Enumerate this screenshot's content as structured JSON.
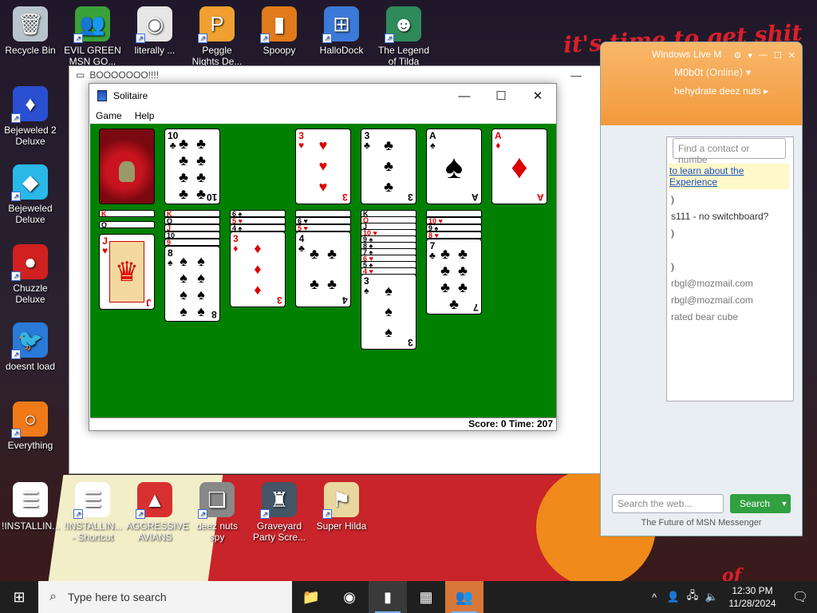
{
  "wallpaper": {
    "banner_text": "it's time to get shit",
    "bottom_text": "of"
  },
  "desktop_icons": [
    {
      "label": "Recycle Bin",
      "glyph": "🗑",
      "bg": "#b8c4cc",
      "shortcut": false
    },
    {
      "label": "EVIL GREEN MSN GO...",
      "glyph": "👥",
      "bg": "#3aa23a",
      "shortcut": true
    },
    {
      "label": "literally ...",
      "glyph": "◉",
      "bg": "#e6e6e6",
      "shortcut": true
    },
    {
      "label": "Peggle Nights De...",
      "glyph": "P",
      "bg": "#f0a030",
      "shortcut": true
    },
    {
      "label": "Spoopy",
      "glyph": "▮",
      "bg": "#e07a1a",
      "shortcut": true
    },
    {
      "label": "HalloDock",
      "glyph": "⊞",
      "bg": "#3b7ad8",
      "shortcut": true
    },
    {
      "label": "The Legend of Tilda",
      "glyph": "☻",
      "bg": "#2f8a5a",
      "shortcut": true
    },
    {
      "label": "Bejeweled 2 Deluxe",
      "glyph": "♦",
      "bg": "#2a4fd0",
      "shortcut": true
    },
    {
      "label": "Bejeweled Deluxe",
      "glyph": "◆",
      "bg": "#2ab8e8",
      "shortcut": true
    },
    {
      "label": "Chuzzle Deluxe",
      "glyph": "●",
      "bg": "#d02020",
      "shortcut": true
    },
    {
      "label": "doesnt load",
      "glyph": "🐦",
      "bg": "#2a7ad8",
      "shortcut": true
    },
    {
      "label": "Everything",
      "glyph": "○",
      "bg": "#f07a1a",
      "shortcut": true
    },
    {
      "label": "!INSTALLIN...",
      "glyph": "☰",
      "bg": "#ffffff",
      "shortcut": false
    },
    {
      "label": "!INSTALLIN... - Shortcut",
      "glyph": "☰",
      "bg": "#ffffff",
      "shortcut": true
    },
    {
      "label": "AGGRESSIVE AVIANS",
      "glyph": "▲",
      "bg": "#d83030",
      "shortcut": true
    },
    {
      "label": "deez nuts spy",
      "glyph": "❏",
      "bg": "#888888",
      "shortcut": true
    },
    {
      "label": "Graveyard Party Scre...",
      "glyph": "♜",
      "bg": "#445566",
      "shortcut": true
    },
    {
      "label": "Super Hilda",
      "glyph": "⚑",
      "bg": "#e8d8a0",
      "shortcut": true
    }
  ],
  "ghost_window": {
    "title": "BOOOOOOO!!!!"
  },
  "solitaire": {
    "title": "Solitaire",
    "menu": [
      "Game",
      "Help"
    ],
    "minimize": "—",
    "maximize": "☐",
    "close": "✕",
    "score_label": "Score: 0 Time: 207",
    "stock": {
      "back": true
    },
    "waste": {
      "rank": "10",
      "suit": "♣",
      "color": "b"
    },
    "foundations": [
      {
        "rank": "3",
        "suit": "♥",
        "color": "r"
      },
      {
        "rank": "3",
        "suit": "♣",
        "color": "b"
      },
      {
        "rank": "A",
        "suit": "♠",
        "color": "b"
      },
      {
        "rank": "A",
        "suit": "♦",
        "color": "r"
      }
    ],
    "tableau": [
      {
        "strips": [
          {
            "t": "K",
            "c": "r"
          },
          {
            "t": "Q",
            "c": "b"
          }
        ],
        "top": {
          "rank": "J",
          "suit": "♥",
          "color": "r"
        }
      },
      {
        "strips": [
          {
            "t": "K",
            "c": "r"
          },
          {
            "t": "Q",
            "c": "b"
          },
          {
            "t": "J",
            "c": "r"
          },
          {
            "t": "10",
            "c": "b"
          },
          {
            "t": "9",
            "c": "r"
          }
        ],
        "top": {
          "rank": "8",
          "suit": "♠",
          "color": "b"
        }
      },
      {
        "strips": [
          {
            "t": "6 ♠",
            "c": "b"
          },
          {
            "t": "5 ♥",
            "c": "r"
          },
          {
            "t": "4 ♠",
            "c": "b"
          }
        ],
        "top": {
          "rank": "3",
          "suit": "♦",
          "color": "r"
        }
      },
      {
        "strips": [
          {
            "t": "",
            "c": "b"
          },
          {
            "t": "6 ♥",
            "c": "b"
          },
          {
            "t": "5 ♥",
            "c": "r"
          }
        ],
        "top": {
          "rank": "4",
          "suit": "♣",
          "color": "b"
        }
      },
      {
        "strips": [
          {
            "t": "K",
            "c": "b"
          },
          {
            "t": "Q",
            "c": "r"
          },
          {
            "t": "J",
            "c": "b"
          },
          {
            "t": "10 ♥",
            "c": "r"
          },
          {
            "t": "9 ♠",
            "c": "b"
          },
          {
            "t": "8 ♠",
            "c": "b"
          },
          {
            "t": "7 ♠",
            "c": "b"
          },
          {
            "t": "6 ♥",
            "c": "r"
          },
          {
            "t": "5 ♠",
            "c": "b"
          },
          {
            "t": "4 ♥",
            "c": "r"
          }
        ],
        "top": {
          "rank": "3",
          "suit": "♠",
          "color": "b"
        }
      },
      {
        "strips": [
          {
            "t": "",
            "c": "b"
          },
          {
            "t": "10 ♥",
            "c": "r"
          },
          {
            "t": "9 ♠",
            "c": "b"
          },
          {
            "t": "8 ♥",
            "c": "r"
          }
        ],
        "top": {
          "rank": "7",
          "suit": "♣",
          "color": "b"
        }
      }
    ]
  },
  "msn": {
    "title": "Windows Live M",
    "username": "M0b0t",
    "status": "(Online) ▾",
    "personal_message": "hehydrate deez nuts ▸",
    "find_placeholder": "Find a contact or numbe",
    "tip_text": "to learn about the Experience",
    "contacts": [
      ")",
      "s111 - no switchboard?",
      ")",
      ")",
      "rbgl@mozmail.com",
      "rbgl@mozmail.com",
      "rated bear cube"
    ],
    "search_placeholder": "Search the web...",
    "search_button": "Search",
    "footer": "The Future of MSN Messenger"
  },
  "taskbar": {
    "search_placeholder": "Type here to search",
    "apps": [
      {
        "name": "file-explorer",
        "glyph": "📁",
        "active": false
      },
      {
        "name": "firefox",
        "glyph": "◉",
        "active": false
      },
      {
        "name": "solitaire",
        "glyph": "▮",
        "active": true
      },
      {
        "name": "window-app",
        "glyph": "▦",
        "active": false
      },
      {
        "name": "msn-messenger",
        "glyph": "👥",
        "active": true
      }
    ],
    "time": "12:30 PM",
    "date": "11/28/2024"
  }
}
